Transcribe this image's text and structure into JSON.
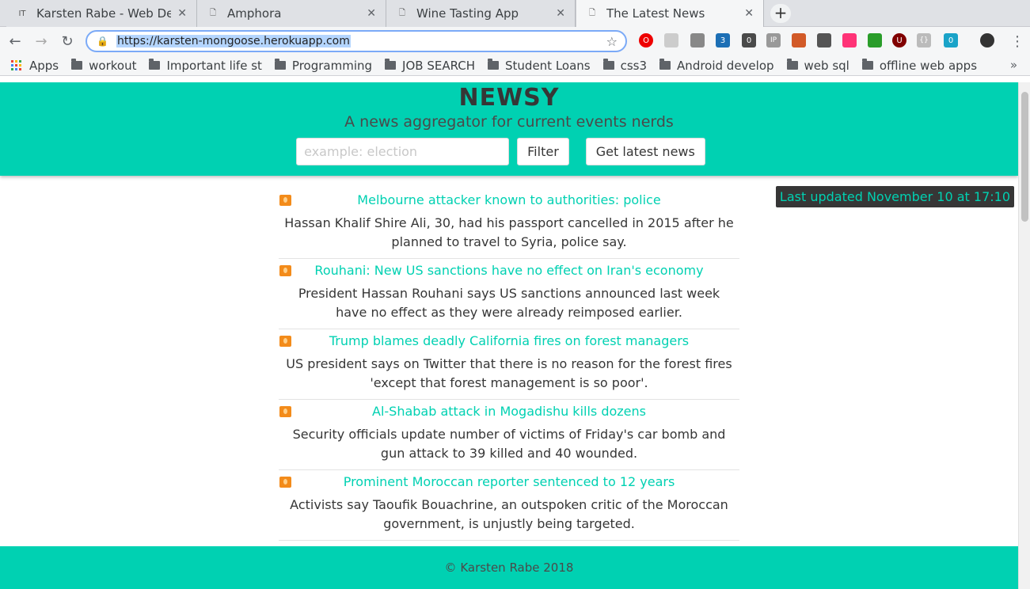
{
  "browser": {
    "tabs": [
      {
        "favicon": "IT",
        "title": "Karsten Rabe - Web Devel"
      },
      {
        "favicon": "page-icon",
        "title": "Amphora"
      },
      {
        "favicon": "page-icon",
        "title": "Wine Tasting App"
      },
      {
        "favicon": "page-icon",
        "title": "The Latest News"
      }
    ],
    "address": "https://karsten-mongoose.herokuapp.com",
    "bookmarks": [
      "Apps",
      "workout",
      "Important life st",
      "Programming",
      "JOB SEARCH",
      "Student Loans",
      "css3",
      "Android develop",
      "web sql",
      "offline web apps"
    ],
    "extension_badges": [
      "3",
      "0",
      "0"
    ]
  },
  "app": {
    "brand": "NEWSY",
    "tagline": "A news aggregator for current events nerds",
    "search_placeholder": "example: election",
    "filter_label": "Filter",
    "latest_label": "Get latest news",
    "last_updated": "Last updated November 10 at 17:10",
    "footer": "© Karsten Rabe 2018",
    "accent_color": "#00d1b2",
    "articles": [
      {
        "title": "Melbourne attacker known to authorities: police",
        "description": "Hassan Khalif Shire Ali, 30, had his passport cancelled in 2015 after he planned to travel to Syria, police say."
      },
      {
        "title": "Rouhani: New US sanctions have no effect on Iran's economy",
        "description": "President Hassan Rouhani says US sanctions announced last week have no effect as they were already reimposed earlier."
      },
      {
        "title": "Trump blames deadly California fires on forest managers",
        "description": "US president says on Twitter that there is no reason for the forest fires 'except that forest management is so poor'."
      },
      {
        "title": "Al-Shabab attack in Mogadishu kills dozens",
        "description": "Security officials update number of victims of Friday's car bomb and gun attack to 39 killed and 40 wounded."
      },
      {
        "title": "Prominent Moroccan reporter sentenced to 12 years",
        "description": "Activists say Taoufik Bouachrine, an outspoken critic of the Moroccan government, is unjustly being targeted."
      }
    ]
  }
}
